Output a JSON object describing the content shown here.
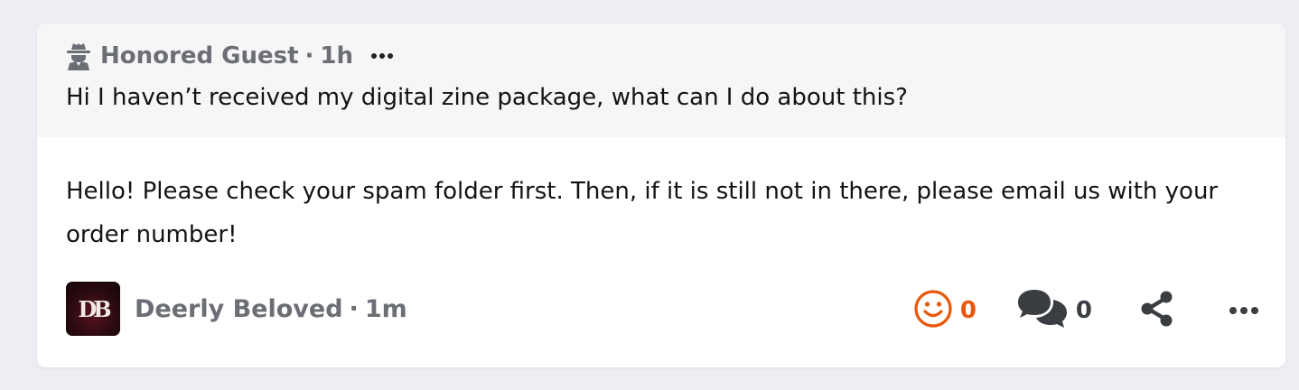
{
  "question": {
    "author": "Honored Guest",
    "separator": "·",
    "time": "1h",
    "text": "Hi I haven’t received my digital zine package, what can I do about this?"
  },
  "answer": {
    "text": "Hello! Please check your spam folder first. Then, if it is still not in there, please email us with your order number!",
    "author": "Deerly Beloved",
    "separator": "·",
    "time": "1m",
    "avatar_monogram": "DB"
  },
  "actions": {
    "reaction_count": "0",
    "comment_count": "0"
  },
  "icons": {
    "anonymous": "spy-icon",
    "reaction": "smiley-icon",
    "comment": "comments-icon",
    "share": "share-icon",
    "more": "more-dots-icon"
  },
  "colors": {
    "accent": "#e8580c",
    "muted_text": "#6b6e74",
    "body_text": "#121316",
    "question_bg": "#f6f6f7",
    "page_bg": "#eeedf3"
  }
}
